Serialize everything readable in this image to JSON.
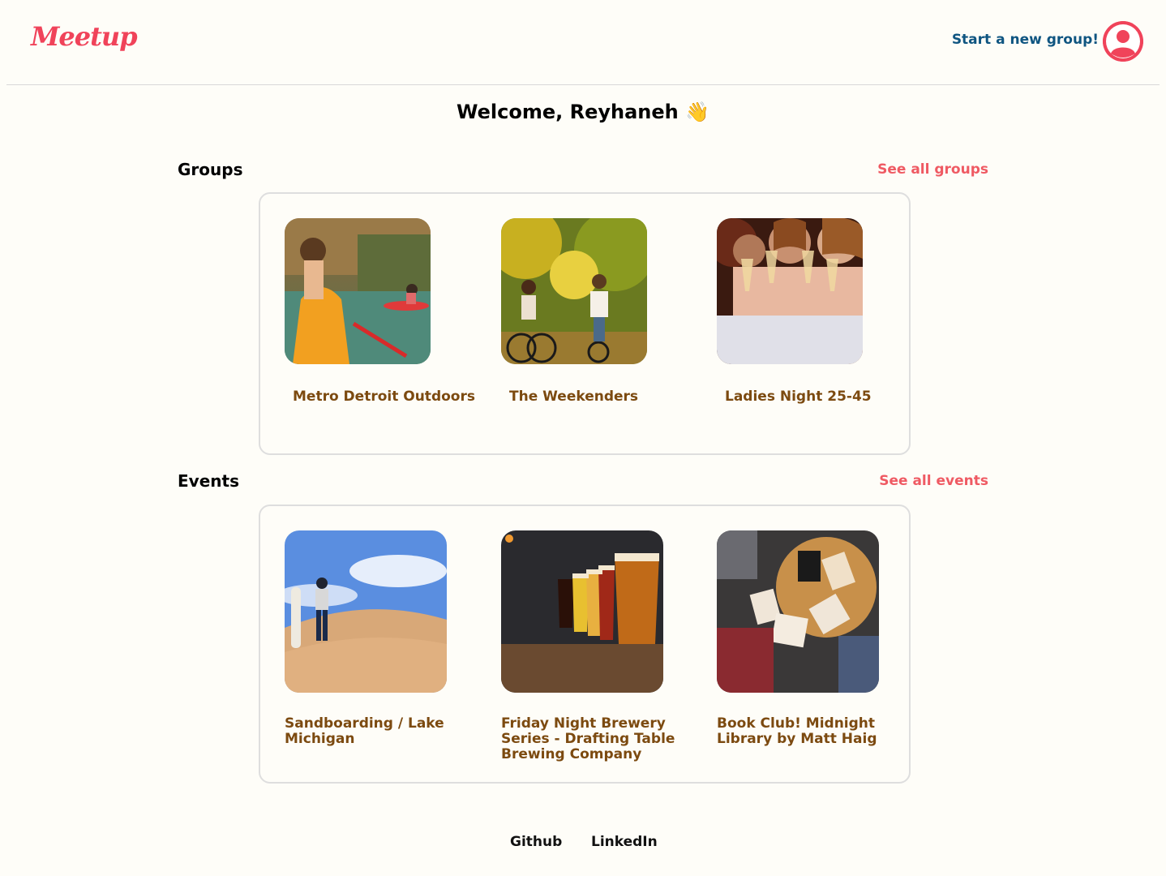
{
  "header": {
    "logo_text": "Meetup",
    "start_group_label": "Start a new group!",
    "avatar_icon": "user-avatar-icon",
    "brand_color": "#f0435a"
  },
  "welcome": {
    "text": "Welcome, Reyhaneh 👋"
  },
  "groups": {
    "title": "Groups",
    "see_all_label": "See all groups",
    "items": [
      {
        "name": "Metro Detroit Outdoors"
      },
      {
        "name": "The Weekenders"
      },
      {
        "name": "Ladies Night 25-45"
      }
    ]
  },
  "events": {
    "title": "Events",
    "see_all_label": "See all events",
    "items": [
      {
        "name": "Sandboarding / Lake Michigan"
      },
      {
        "name": "Friday Night Brewery Series - Drafting Table Brewing Company"
      },
      {
        "name": "Book Club! Midnight Library by Matt Haig"
      }
    ]
  },
  "footer": {
    "links": [
      "Github",
      "LinkedIn"
    ]
  },
  "colors": {
    "accent": "#ef5a63",
    "link_blue": "#0f5581",
    "card_title": "#7c4a10",
    "background": "#fefdf8"
  }
}
